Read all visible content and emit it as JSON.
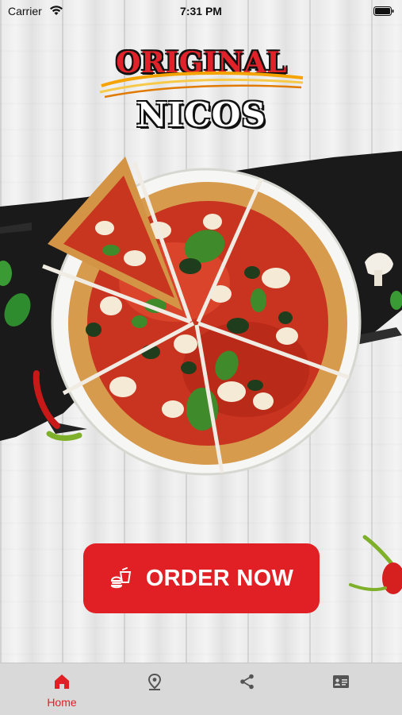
{
  "status_bar": {
    "carrier": "Carrier",
    "time": "7:31 PM",
    "wifi_icon": "wifi-icon",
    "battery_icon": "battery-icon"
  },
  "logo": {
    "line1": "ORIGINAL",
    "line2": "NICOS"
  },
  "hero": {
    "image": "pizza-image"
  },
  "order_button": {
    "label": "ORDER NOW",
    "icon": "food-icon",
    "color": "#e02024"
  },
  "tab_bar": {
    "active_color": "#e02024",
    "inactive_color": "#555555",
    "tabs": [
      {
        "label": "Home",
        "icon": "home-icon",
        "active": true
      },
      {
        "label": "",
        "icon": "location-pin-icon",
        "active": false
      },
      {
        "label": "",
        "icon": "share-icon",
        "active": false
      },
      {
        "label": "",
        "icon": "contact-card-icon",
        "active": false
      }
    ]
  }
}
